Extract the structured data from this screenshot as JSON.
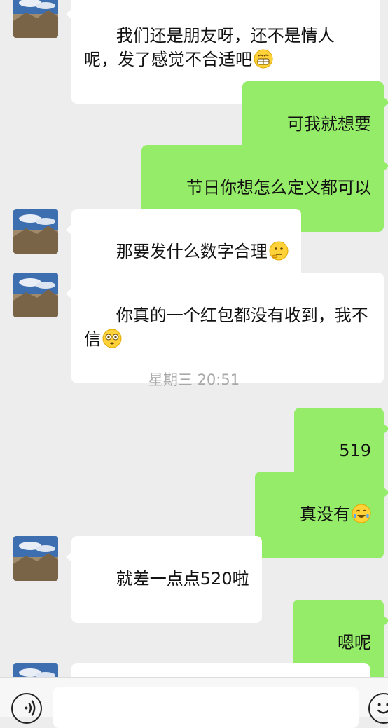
{
  "messages": [
    {
      "side": "left",
      "text": "我们还是朋友呀，还不是情人呢，发了感觉不合适吧",
      "emoji": "grin"
    },
    {
      "side": "right",
      "text": "可我就想要"
    },
    {
      "side": "right",
      "text": "节日你想怎么定义都可以"
    },
    {
      "side": "left",
      "text": "那要发什么数字合理",
      "emoji": "think"
    },
    {
      "side": "left",
      "text": "你真的一个红包都没有收到，我不信",
      "emoji": "flushed"
    },
    {
      "side": "right",
      "text": "519"
    },
    {
      "side": "right",
      "text": "真没有",
      "emoji": "laugh-cry"
    },
    {
      "side": "left",
      "text": "就差一点点520啦"
    },
    {
      "side": "right",
      "text": "嗯呢"
    }
  ],
  "timestamp": "星期三 20:51",
  "colors": {
    "background": "#ededed",
    "bubble_self": "#95ec69",
    "bubble_other": "#ffffff",
    "timestamp": "#a8a8a8"
  },
  "icons": {
    "voice": "voice-icon",
    "emoji": "emoji-icon"
  }
}
